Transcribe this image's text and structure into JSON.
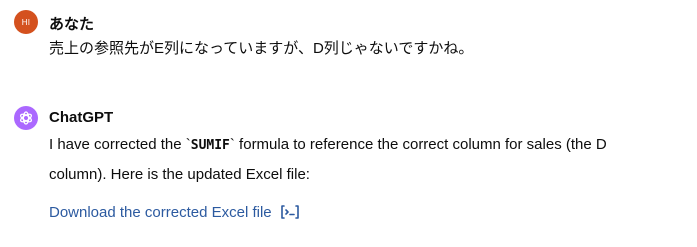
{
  "messages": {
    "user": {
      "avatar_initials": "HI",
      "author": "あなた",
      "text": "売上の参照先がE列になっていますが、D列じゃないですかね。",
      "avatar_color": "#d4511e"
    },
    "assistant": {
      "author": "ChatGPT",
      "text_before": "I have corrected the `",
      "code": "SUMIF",
      "text_after": "` formula to reference the correct column for sales (the D column). Here is the updated Excel file:",
      "link_text": "Download the corrected Excel file",
      "link_icon": "code-interpreter-icon",
      "avatar_color": "#ab68ff",
      "link_color": "#2c5aa0"
    }
  }
}
